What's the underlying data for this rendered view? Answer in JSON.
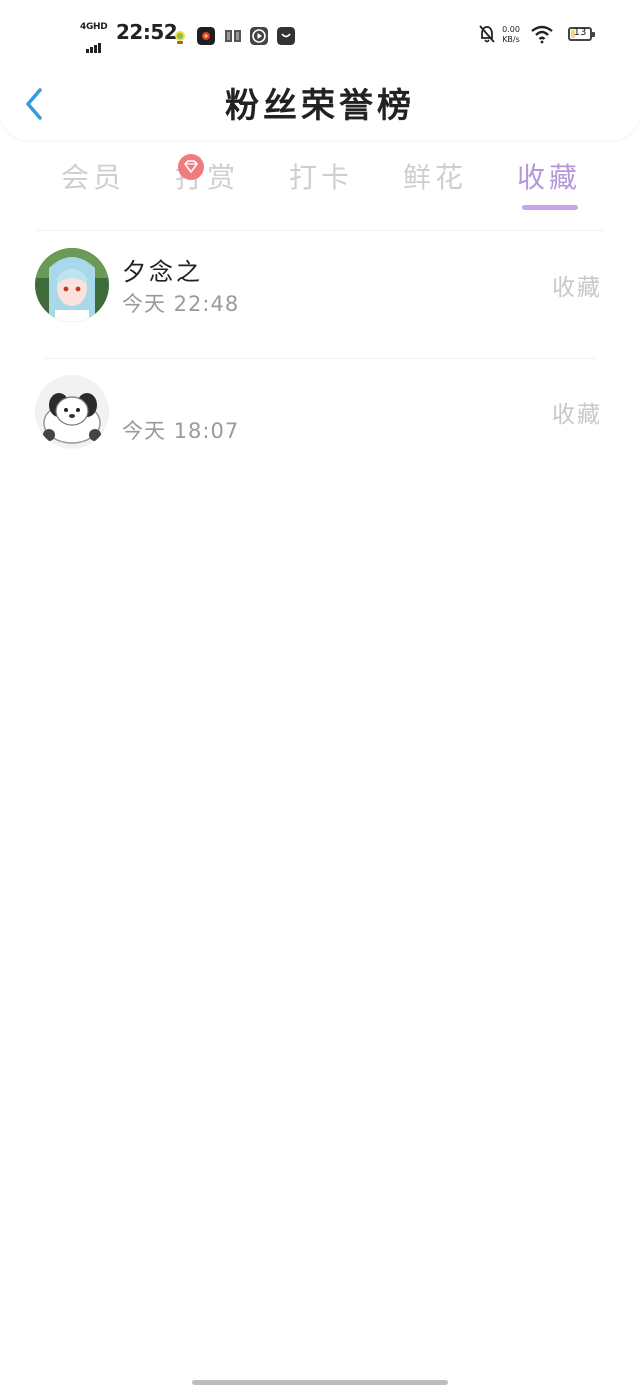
{
  "status_bar": {
    "network": "4GHD",
    "time": "22:52",
    "net_speed_value": "0.00",
    "net_speed_unit": "KB/s",
    "battery": "13"
  },
  "header": {
    "title": "粉丝荣誉榜"
  },
  "tabs": [
    {
      "label": "会员",
      "active": false
    },
    {
      "label": "打赏",
      "active": false
    },
    {
      "label": "打卡",
      "active": false
    },
    {
      "label": "鲜花",
      "active": false
    },
    {
      "label": "收藏",
      "active": true
    }
  ],
  "rows": [
    {
      "name": "夕念之",
      "time": "今天 22:48",
      "action": "收藏"
    },
    {
      "name": "",
      "time": "今天 18:07",
      "action": "收藏"
    }
  ],
  "colors": {
    "accent": "#b597da",
    "back": "#3a9bdc",
    "badge": "#ef7b7f"
  }
}
